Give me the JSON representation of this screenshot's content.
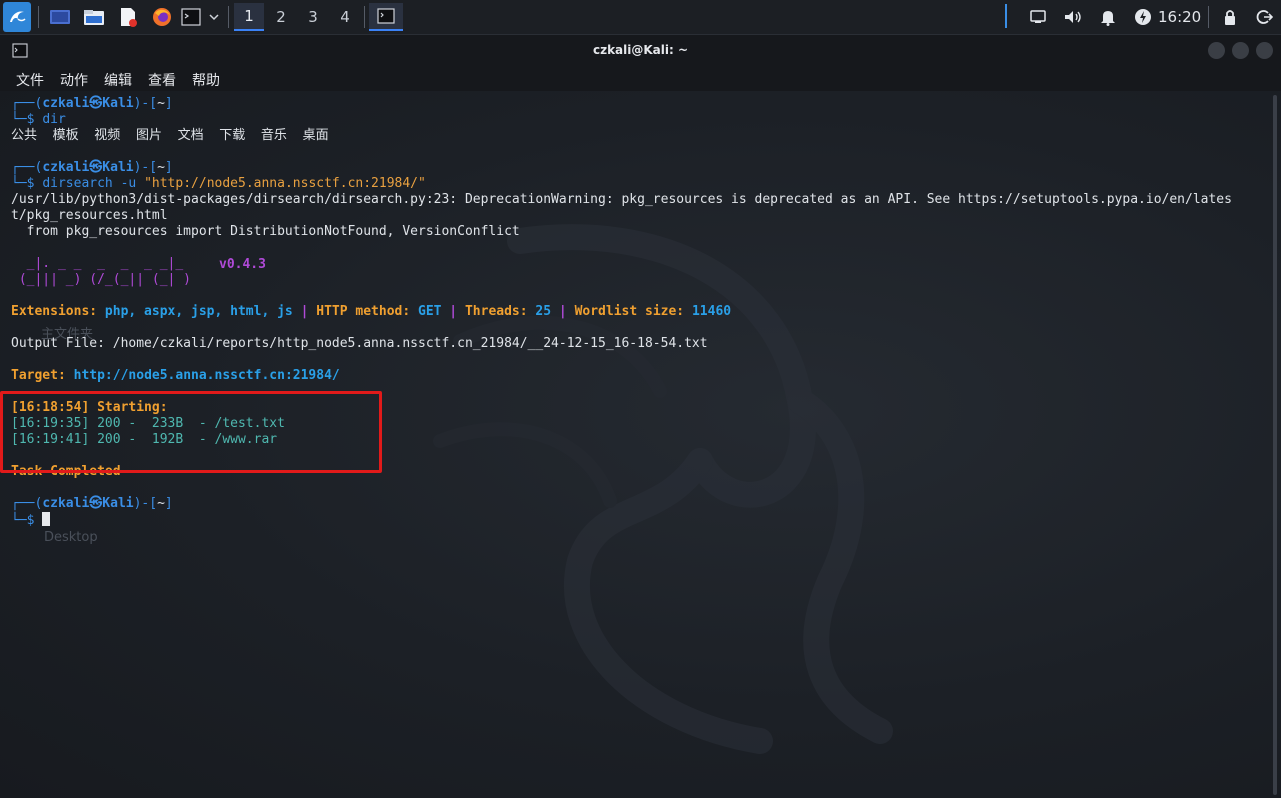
{
  "taskbar": {
    "workspaces": [
      "1",
      "2",
      "3",
      "4"
    ],
    "active_workspace": "1",
    "clock": "16:20"
  },
  "window": {
    "title": "czkali@Kali: ~",
    "menu": [
      "文件",
      "动作",
      "编辑",
      "查看",
      "帮助"
    ]
  },
  "terminal": {
    "prompt": {
      "user": "czkali",
      "at": "㉿",
      "host": "Kali",
      "dir": "~"
    },
    "cmd1": "dir",
    "dir_output": "公共  模板  视频  图片  文档  下载  音乐  桌面",
    "cmd2_name": "dirsearch",
    "cmd2_flag": " -u ",
    "cmd2_arg": "\"http://node5.anna.nssctf.cn:21984/\"",
    "warning_line1": "/usr/lib/python3/dist-packages/dirsearch/dirsearch.py:23: DeprecationWarning: pkg_resources is deprecated as an API. See https://setuptools.pypa.io/en/lates",
    "warning_line2": "t/pkg_resources.html",
    "warning_line3": "  from pkg_resources import DistributionNotFound, VersionConflict",
    "banner_line1": "  _|. _ _  _  _  _ _|_",
    "banner_line2": " (_||| _) (/_(_|| (_| )",
    "version": "v0.4.3",
    "ext_label": "Extensions: ",
    "ext_value": "php, aspx, jsp, html, js",
    "method_label": "HTTP method: ",
    "method_value": "GET",
    "threads_label": "Threads: ",
    "threads_value": "25",
    "wordlist_label": "Wordlist size: ",
    "wordlist_value": "11460",
    "output_file": "Output File: /home/czkali/reports/http_node5.anna.nssctf.cn_21984/__24-12-15_16-18-54.txt",
    "target_label": "Target: ",
    "target_value": "http://node5.anna.nssctf.cn:21984/",
    "starting": "[16:18:54] Starting:",
    "results": [
      "[16:19:35] 200 -  233B  - /test.txt",
      "[16:19:41] 200 -  192B  - /www.rar"
    ],
    "completed": "Task Completed",
    "pipe_sep": " | "
  },
  "desktop_ghost": {
    "label1": "主文件夹",
    "label2": "Desktop"
  },
  "colors": {
    "accent": "#3a8ee6",
    "highlight_box": "#e11a1a",
    "kali_menu": "#2f86d8"
  }
}
